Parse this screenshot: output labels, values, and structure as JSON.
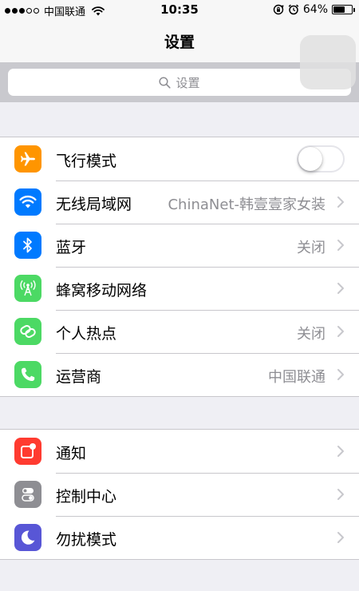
{
  "status_bar": {
    "carrier": "中国联通",
    "time": "10:35",
    "battery_text": "64%",
    "battery_level": 0.64,
    "icons": [
      "signal-dots-icon",
      "wifi-icon",
      "rotation-lock-icon",
      "alarm-icon",
      "battery-icon"
    ]
  },
  "nav": {
    "title": "设置"
  },
  "search": {
    "placeholder": "设置"
  },
  "group1": [
    {
      "label": "飞行模式",
      "icon": "airplane-icon",
      "color": "#ff9500",
      "toggle": false
    },
    {
      "label": "无线局域网",
      "icon": "wifi-icon",
      "color": "#007aff",
      "value": "ChinaNet-韩壹壹家女装"
    },
    {
      "label": "蓝牙",
      "icon": "bluetooth-icon",
      "color": "#007aff",
      "value": "关闭"
    },
    {
      "label": "蜂窝移动网络",
      "icon": "cellular-antenna-icon",
      "color": "#4cd964",
      "value": ""
    },
    {
      "label": "个人热点",
      "icon": "hotspot-link-icon",
      "color": "#4cd964",
      "value": "关闭"
    },
    {
      "label": "运营商",
      "icon": "phone-icon",
      "color": "#4cd964",
      "value": "中国联通"
    }
  ],
  "group2": [
    {
      "label": "通知",
      "icon": "notification-icon",
      "color": "#ff3b30"
    },
    {
      "label": "控制中心",
      "icon": "control-center-icon",
      "color": "#8e8e93"
    },
    {
      "label": "勿扰模式",
      "icon": "moon-icon",
      "color": "#5856d6"
    }
  ],
  "colors": {
    "background": "#efeff4",
    "separator": "#c8c7cc",
    "secondary_text": "#8e8e93",
    "chevron": "#c7c7cc"
  }
}
